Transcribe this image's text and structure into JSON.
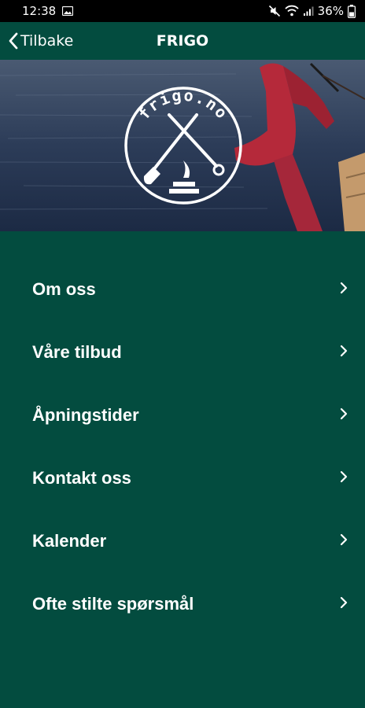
{
  "status_bar": {
    "time": "12:38",
    "battery": "36%",
    "icons": [
      "image-notification-icon",
      "mute-icon",
      "wifi-icon",
      "signal-icon",
      "battery-icon"
    ]
  },
  "nav": {
    "back_label": "Tilbake",
    "title": "FRIGO"
  },
  "hero": {
    "logo_text": "frigo.no"
  },
  "menu": {
    "items": [
      {
        "label": "Om oss"
      },
      {
        "label": "Våre tilbud"
      },
      {
        "label": "Åpningstider"
      },
      {
        "label": "Kontakt oss"
      },
      {
        "label": "Kalender"
      },
      {
        "label": "Ofte stilte spørsmål"
      }
    ]
  },
  "colors": {
    "background": "#034c3f",
    "status_bar": "#000000",
    "text": "#ffffff"
  }
}
